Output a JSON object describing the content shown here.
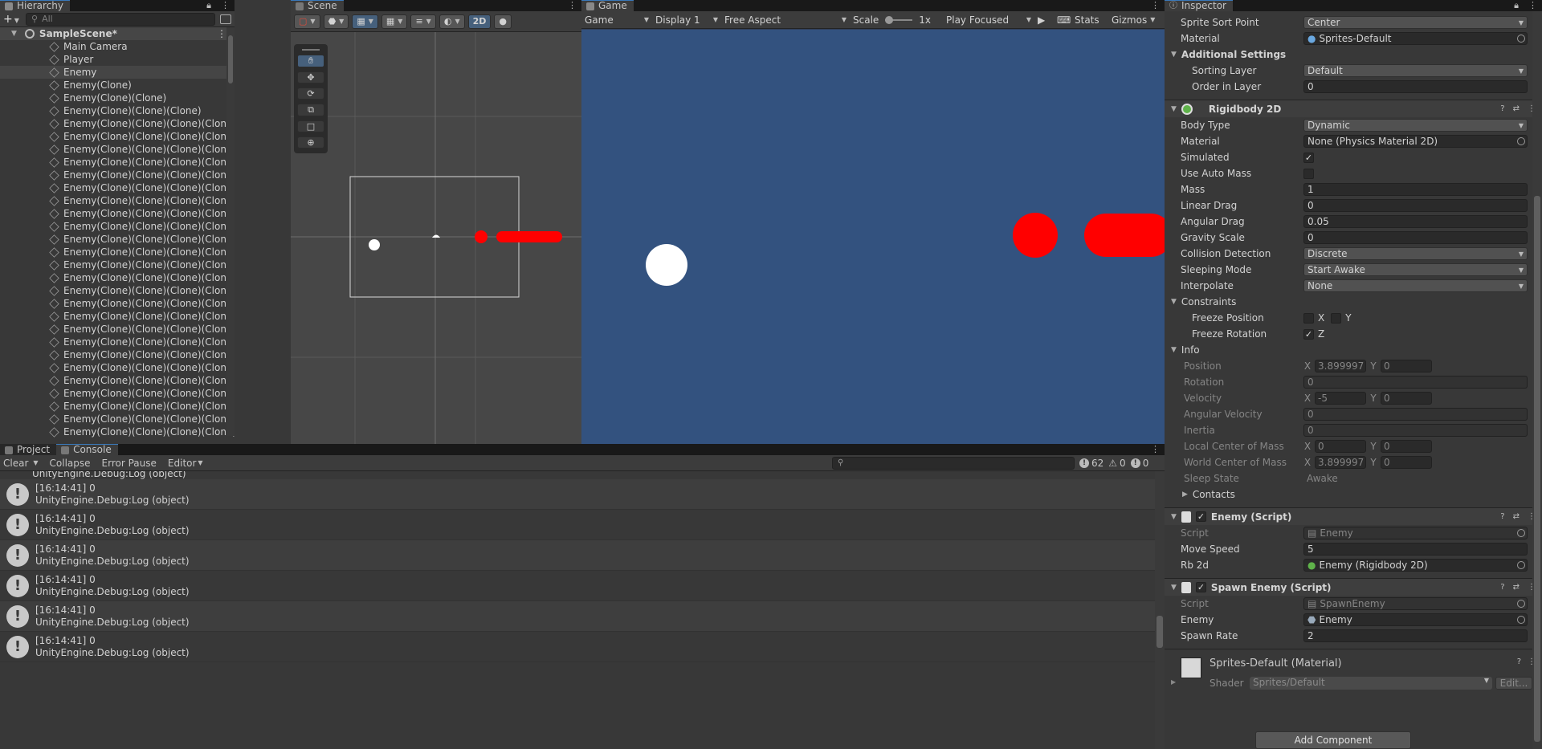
{
  "hierarchy": {
    "tab": "Hierarchy",
    "search_placeholder": "All",
    "scene_name": "SampleScene*",
    "items": [
      "Main Camera",
      "Player",
      "Enemy",
      "Enemy(Clone)",
      "Enemy(Clone)(Clone)",
      "Enemy(Clone)(Clone)(Clone)",
      "Enemy(Clone)(Clone)(Clone)(Clone)",
      "Enemy(Clone)(Clone)(Clone)(Clone)(Clone)",
      "Enemy(Clone)(Clone)(Clone)(Clone)(Clone)(Clo",
      "Enemy(Clone)(Clone)(Clone)(Clone)(Clone)(Clo",
      "Enemy(Clone)(Clone)(Clone)(Clone)(Clone)(Clo",
      "Enemy(Clone)(Clone)(Clone)(Clone)(Clone)(Clo",
      "Enemy(Clone)(Clone)(Clone)(Clone)(Clone)(Clo",
      "Enemy(Clone)(Clone)(Clone)(Clone)(Clone)(Clo",
      "Enemy(Clone)(Clone)(Clone)(Clone)(Clone)(Clo",
      "Enemy(Clone)(Clone)(Clone)(Clone)(Clone)(Clo",
      "Enemy(Clone)(Clone)(Clone)(Clone)(Clone)(Clo",
      "Enemy(Clone)(Clone)(Clone)(Clone)(Clone)(Clo",
      "Enemy(Clone)(Clone)(Clone)(Clone)(Clone)(Clo",
      "Enemy(Clone)(Clone)(Clone)(Clone)(Clone)(Clo",
      "Enemy(Clone)(Clone)(Clone)(Clone)(Clone)(Clo",
      "Enemy(Clone)(Clone)(Clone)(Clone)(Clone)(Clo",
      "Enemy(Clone)(Clone)(Clone)(Clone)(Clone)(Clo",
      "Enemy(Clone)(Clone)(Clone)(Clone)(Clone)(Clo",
      "Enemy(Clone)(Clone)(Clone)(Clone)(Clone)(Clo",
      "Enemy(Clone)(Clone)(Clone)(Clone)(Clone)(Clo",
      "Enemy(Clone)(Clone)(Clone)(Clone)(Clone)(Clo",
      "Enemy(Clone)(Clone)(Clone)(Clone)(Clone)(Clo",
      "Enemy(Clone)(Clone)(Clone)(Clone)(Clone)(Clo",
      "Enemy(Clone)(Clone)(Clone)(Clone)(Clone)(Clo",
      "Enemy(Clone)(Clone)(Clone)(Clone)(Clone)(Clo"
    ]
  },
  "scene": {
    "tab": "Scene",
    "mode_2d": "2D"
  },
  "game": {
    "tab": "Game",
    "view": "Game",
    "display": "Display 1",
    "aspect": "Free Aspect",
    "scale_label": "Scale",
    "scale_value": "1x",
    "play_mode": "Play Focused",
    "stats": "Stats",
    "gizmos": "Gizmos",
    "background": "#33527f"
  },
  "inspector": {
    "tab": "Inspector",
    "sprite_sort_point": {
      "label": "Sprite Sort Point",
      "value": "Center"
    },
    "material": {
      "label": "Material",
      "value": "Sprites-Default"
    },
    "additional_settings": "Additional Settings",
    "sorting_layer": {
      "label": "Sorting Layer",
      "value": "Default"
    },
    "order_in_layer": {
      "label": "Order in Layer",
      "value": "0"
    },
    "rigidbody": {
      "title": "Rigidbody 2D",
      "body_type": {
        "label": "Body Type",
        "value": "Dynamic"
      },
      "material": {
        "label": "Material",
        "value": "None (Physics Material 2D)"
      },
      "simulated": {
        "label": "Simulated"
      },
      "use_auto_mass": {
        "label": "Use Auto Mass"
      },
      "mass": {
        "label": "Mass",
        "value": "1"
      },
      "linear_drag": {
        "label": "Linear Drag",
        "value": "0"
      },
      "angular_drag": {
        "label": "Angular Drag",
        "value": "0.05"
      },
      "gravity_scale": {
        "label": "Gravity Scale",
        "value": "0"
      },
      "collision_detection": {
        "label": "Collision Detection",
        "value": "Discrete"
      },
      "sleeping_mode": {
        "label": "Sleeping Mode",
        "value": "Start Awake"
      },
      "interpolate": {
        "label": "Interpolate",
        "value": "None"
      },
      "constraints": "Constraints",
      "freeze_position": "Freeze Position",
      "freeze_rotation": "Freeze Rotation",
      "axis_x": "X",
      "axis_y": "Y",
      "axis_z": "Z",
      "info": "Info",
      "position": {
        "label": "Position",
        "x": "3.899997",
        "y": "0"
      },
      "rotation": {
        "label": "Rotation",
        "value": "0"
      },
      "velocity": {
        "label": "Velocity",
        "x": "-5",
        "y": "0"
      },
      "angular_velocity": {
        "label": "Angular Velocity",
        "value": "0"
      },
      "inertia": {
        "label": "Inertia",
        "value": "0"
      },
      "local_com": {
        "label": "Local Center of Mass",
        "x": "0",
        "y": "0"
      },
      "world_com": {
        "label": "World Center of Mass",
        "x": "3.899997",
        "y": "0"
      },
      "sleep_state": {
        "label": "Sleep State",
        "value": "Awake"
      },
      "contacts": "Contacts"
    },
    "enemy_script": {
      "title": "Enemy (Script)",
      "script": {
        "label": "Script",
        "value": "Enemy"
      },
      "move_speed": {
        "label": "Move Speed",
        "value": "5"
      },
      "rb2d": {
        "label": "Rb 2d",
        "value": "Enemy (Rigidbody 2D)"
      }
    },
    "spawn_script": {
      "title": "Spawn Enemy (Script)",
      "script": {
        "label": "Script",
        "value": "SpawnEnemy"
      },
      "enemy": {
        "label": "Enemy",
        "value": "Enemy"
      },
      "spawn_rate": {
        "label": "Spawn Rate",
        "value": "2"
      }
    },
    "material_asset": {
      "title": "Sprites-Default (Material)",
      "shader_label": "Shader",
      "shader_value": "Sprites/Default",
      "edit": "Edit..."
    },
    "add_component": "Add Component"
  },
  "console": {
    "tab_project": "Project",
    "tab_console": "Console",
    "clear": "Clear",
    "collapse": "Collapse",
    "error_pause": "Error Pause",
    "editor": "Editor",
    "count_log": "62",
    "count_warn": "0",
    "count_err": "0",
    "partial_line": "UnityEngine.Debug:Log (object)",
    "logs": [
      {
        "time": "[16:14:41] 0",
        "src": "UnityEngine.Debug:Log (object)"
      },
      {
        "time": "[16:14:41] 0",
        "src": "UnityEngine.Debug:Log (object)"
      },
      {
        "time": "[16:14:41] 0",
        "src": "UnityEngine.Debug:Log (object)"
      },
      {
        "time": "[16:14:41] 0",
        "src": "UnityEngine.Debug:Log (object)"
      },
      {
        "time": "[16:14:41] 0",
        "src": "UnityEngine.Debug:Log (object)"
      },
      {
        "time": "[16:14:41] 0",
        "src": "UnityEngine.Debug:Log (object)"
      }
    ]
  }
}
